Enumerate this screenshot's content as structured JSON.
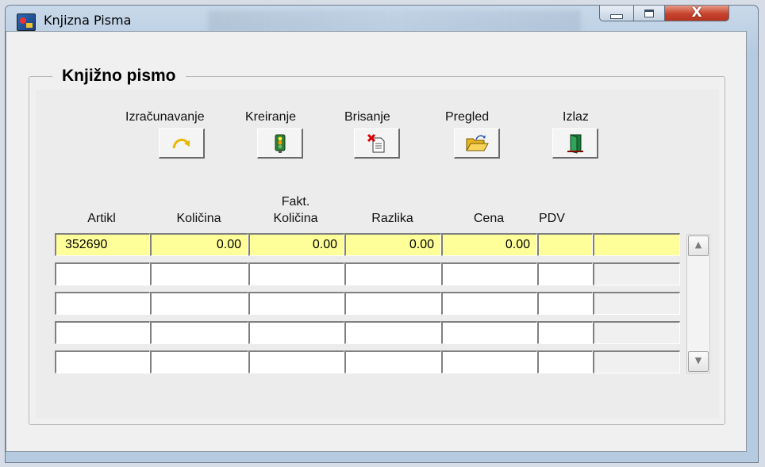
{
  "window": {
    "title": "Knjizna Pisma",
    "controls": {
      "close_glyph": "X"
    }
  },
  "group": {
    "title": "Knjižno pismo"
  },
  "toolbar": {
    "calculate_label": "Izračunavanje",
    "create_label": "Kreiranje",
    "delete_label": "Brisanje",
    "preview_label": "Pregled",
    "exit_label": "Izlaz"
  },
  "icons": {
    "calculate": "refresh-arrow-icon",
    "create": "traffic-light-icon",
    "delete": "delete-document-icon",
    "preview": "open-folder-icon",
    "exit": "door-exit-icon"
  },
  "grid": {
    "headers": {
      "artikl": "Artikl",
      "kolicina": "Količina",
      "fakt_line1": "Fakt.",
      "fakt_line2": "Količina",
      "razlika": "Razlika",
      "cena": "Cena",
      "pdv": "PDV"
    },
    "rows": [
      [
        "352690",
        "0.00",
        "0.00",
        "0.00",
        "0.00",
        "",
        ""
      ],
      [
        "",
        "",
        "",
        "",
        "",
        "",
        ""
      ],
      [
        "",
        "",
        "",
        "",
        "",
        "",
        ""
      ],
      [
        "",
        "",
        "",
        "",
        "",
        "",
        ""
      ],
      [
        "",
        "",
        "",
        "",
        "",
        "",
        ""
      ]
    ]
  },
  "colors": {
    "highlight_row": "#ffff99",
    "close_button": "#c7432d",
    "title_bar": "#b7cbe0"
  }
}
